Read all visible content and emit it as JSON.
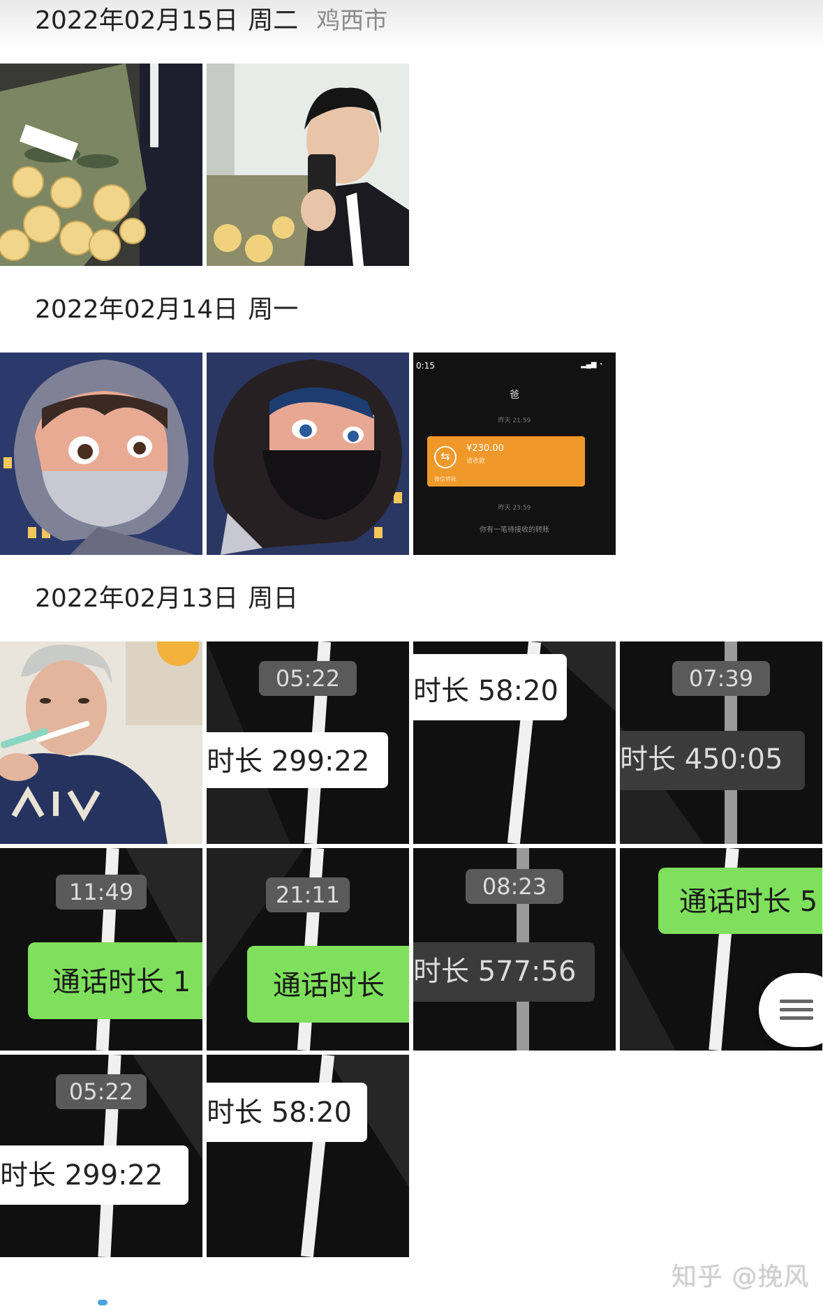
{
  "sections": [
    {
      "date": "2022年02月15日",
      "weekday": "周二",
      "location": "鸡西市"
    },
    {
      "date": "2022年02月14日",
      "weekday": "周一"
    },
    {
      "date": "2022年02月13日",
      "weekday": "周日"
    }
  ],
  "transfer_screenshot": {
    "time": "0:15",
    "contact": "爸",
    "ts1": "昨天 21:59",
    "amount": "¥230.00",
    "amount_sub": "请收款",
    "card_footer": "微信转账",
    "ts2": "昨天 23:59",
    "notice": "你有一笔待接收的转账"
  },
  "call_thumbs": [
    {
      "time": "05:22",
      "duration": "时长 299:22"
    },
    {
      "duration": "时长 58:20"
    },
    {
      "time": "07:39",
      "duration": "时长 450:05"
    },
    {
      "time": "11:49",
      "duration": "通话时长 1"
    },
    {
      "time": "21:11",
      "duration": "通话时长"
    },
    {
      "time": "08:23",
      "duration": "时长 577:56"
    },
    {
      "duration": "通话时长 5"
    },
    {
      "time": "05:22",
      "duration": "时长 299:22"
    },
    {
      "duration": "时长 58:20"
    }
  ],
  "watermark": "知乎 @挽风",
  "colors": {
    "green": "#7ee05c",
    "orange": "#f0982a"
  }
}
